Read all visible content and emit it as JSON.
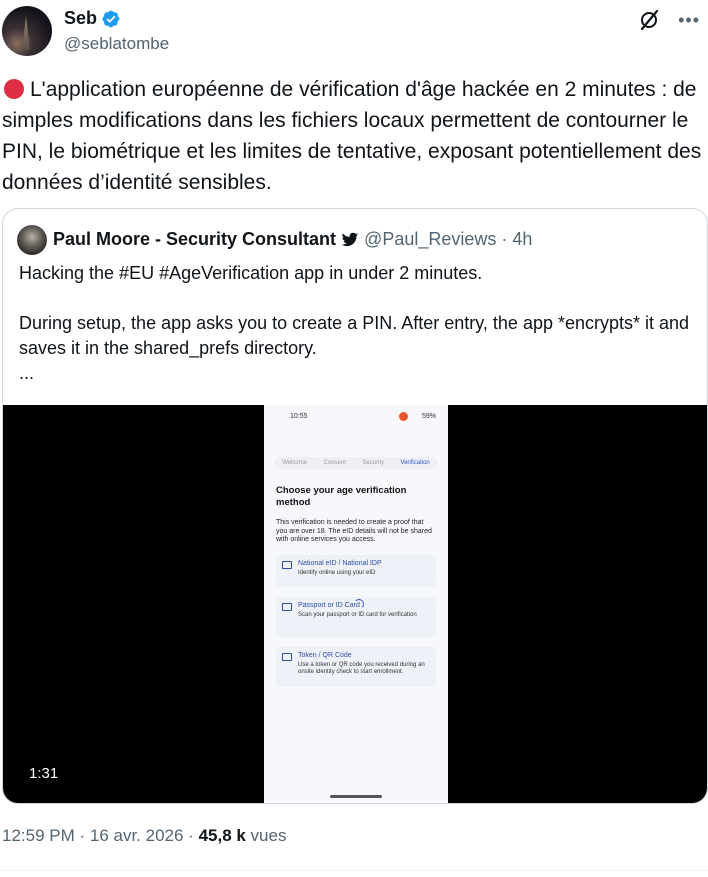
{
  "author": {
    "display_name": "Seb",
    "handle": "@seblatombe",
    "verified": true,
    "verified_color": "#1d9bf0"
  },
  "tweet": {
    "emoji": "red-circle",
    "text": "L'application européenne de vérification d'âge hackée en 2 minutes : de simples modifications dans les fichiers locaux permettent de contourner le PIN, le biométrique et les limites de tentative, exposant potentiellement des données d’identité sensibles."
  },
  "quote": {
    "display_name": "Paul Moore - Security Consultant",
    "handle": "@Paul_Reviews",
    "separator": "·",
    "time": "4h",
    "text_line1": "Hacking the #EU #AgeVerification app in under 2 minutes.",
    "text_line2": "During setup, the app asks you to create a PIN.  After entry, the app *encrypts* it and saves it in the shared_prefs directory.",
    "text_line3": "...",
    "video": {
      "duration": "1:31",
      "status_time": "10:55",
      "status_battery": "59%",
      "steps": [
        "Welcome",
        "Consent",
        "Security",
        "Verification"
      ],
      "title": "Choose your age verification method",
      "description": "This verification is needed to create a proof that you are over 18. The eID details will not be shared with online services you access.",
      "options": [
        {
          "title": "National eID / National IDP",
          "desc": "Identify online using your eID"
        },
        {
          "title": "Passport or ID Card",
          "desc": "Scan your passport or ID card for verification"
        },
        {
          "title": "Token / QR Code",
          "desc": "Use a token or QR code you received during an onsite identity check to start enrollment."
        }
      ]
    }
  },
  "meta": {
    "time": "12:59 PM",
    "sep1": " · ",
    "date": "16 avr. 2026",
    "sep2": " · ",
    "views_count": "45,8 k",
    "views_label": " vues"
  }
}
